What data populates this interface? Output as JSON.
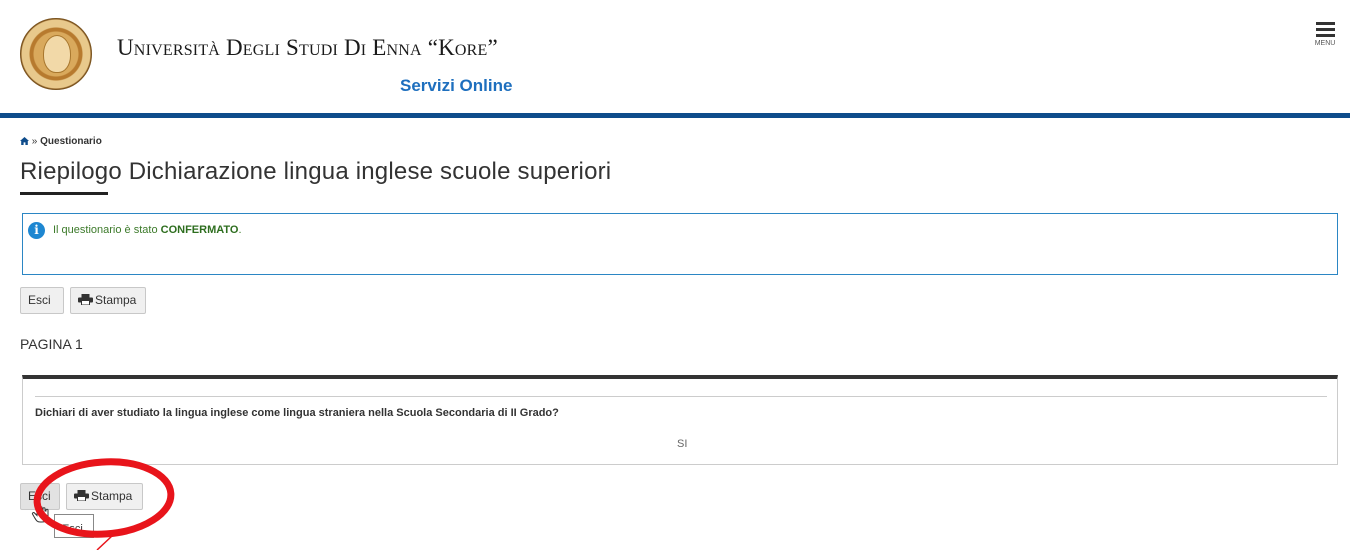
{
  "header": {
    "university_name": "Università Degli Studi Di Enna “Kore”",
    "subtitle": "Servizi Online",
    "menu_label": "MENU",
    "brand_color": "#0e4c8b",
    "logo_icon": "university-seal-logo"
  },
  "breadcrumb": {
    "home_icon": "home-icon",
    "separator": "»",
    "current": "Questionario"
  },
  "page": {
    "title": "Riepilogo Dichiarazione lingua inglese scuole superiori"
  },
  "info": {
    "icon": "info-icon",
    "text_prefix": "Il questionario è stato ",
    "status": "CONFERMATO",
    "text_suffix": ".",
    "status_color": "#2e6e1f"
  },
  "toolbar_top": {
    "exit_label": "Esci",
    "print_label": "Stampa",
    "print_icon": "printer-icon"
  },
  "section": {
    "page_label": "PAGINA 1"
  },
  "question": {
    "text": "Dichiari di aver studiato la lingua inglese come lingua straniera nella Scuola Secondaria di II Grado?",
    "answer": "SI"
  },
  "toolbar_bottom": {
    "exit_label": "Esci",
    "print_label": "Stampa",
    "print_icon": "printer-icon"
  },
  "tooltip": {
    "text": "Esci"
  },
  "annotation": {
    "color": "#e8141b"
  }
}
